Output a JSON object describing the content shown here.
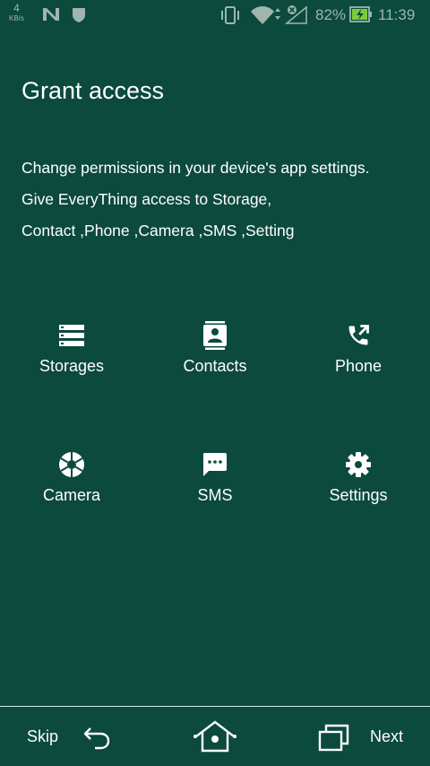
{
  "status_bar": {
    "net_speed_value": "4",
    "net_speed_unit": "KB/s",
    "battery_percent": "82%",
    "time": "11:39",
    "icons": [
      "n-icon",
      "shield-icon",
      "vibrate-icon",
      "wifi-icon",
      "signal-icon",
      "battery-charging-icon"
    ]
  },
  "header": {
    "title": "Grant access"
  },
  "description": {
    "line1": "Change permissions in your device's app settings.",
    "line2": "Give EveryThing access to Storage,",
    "line3": "Contact ,Phone ,Camera ,SMS ,Setting"
  },
  "permissions": [
    {
      "label": "Storages",
      "icon": "storage-icon"
    },
    {
      "label": "Contacts",
      "icon": "contacts-icon"
    },
    {
      "label": "Phone",
      "icon": "phone-forward-icon"
    },
    {
      "label": "Camera",
      "icon": "camera-shutter-icon"
    },
    {
      "label": "SMS",
      "icon": "sms-icon"
    },
    {
      "label": "Settings",
      "icon": "gear-icon"
    }
  ],
  "bottom_bar": {
    "skip_label": "Skip",
    "next_label": "Next",
    "icons": [
      "back-icon",
      "home-icon",
      "recent-apps-icon"
    ]
  },
  "colors": {
    "background": "#0b4a3d",
    "text": "#ffffff",
    "status_text": "#9fb6ad",
    "battery_accent": "#7ecb3a"
  }
}
